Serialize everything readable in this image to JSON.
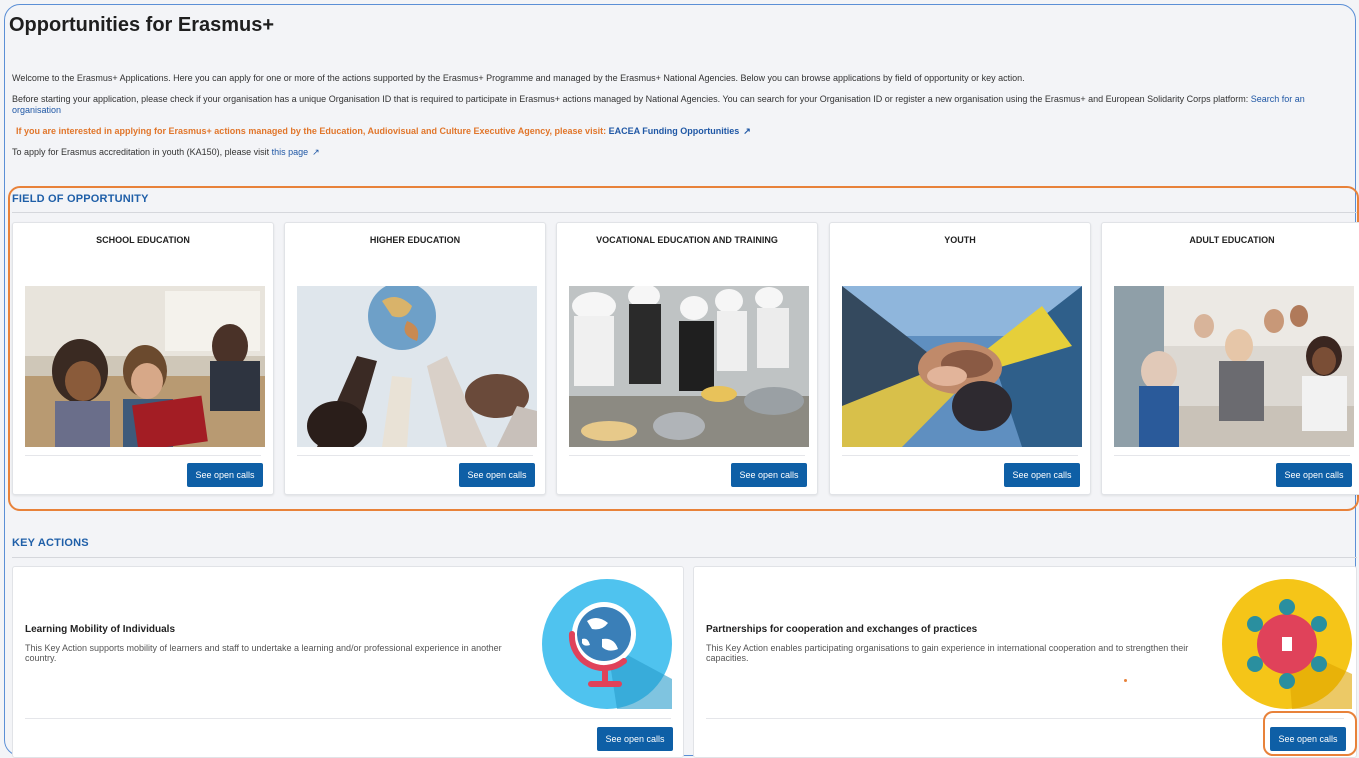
{
  "page": {
    "title": "Opportunities for Erasmus+"
  },
  "intro": {
    "welcome": "Welcome to the Erasmus+ Applications. Here you can apply for one or more of the actions supported by the Erasmus+ Programme and managed by the Erasmus+ National Agencies. Below you can browse applications by field of opportunity or key action.",
    "before_text": "Before starting your application, please check if your organisation has a unique Organisation ID that is required to participate in Erasmus+ actions managed by National Agencies. You can search for your Organisation ID or register a new organisation using the Erasmus+ and European Solidarity Corps platform: ",
    "search_link": "Search for an organisation",
    "eacea_text": "If you are interested in applying for Erasmus+ actions managed by the Education, Audiovisual and Culture Executive Agency, please visit: ",
    "eacea_link": "EACEA Funding Opportunities",
    "accreditation_text": "To apply for Erasmus accreditation in youth (KA150), please visit ",
    "accreditation_link": "this page"
  },
  "field_of_opportunity": {
    "title": "FIELD OF OPPORTUNITY",
    "cards": [
      {
        "title": "SCHOOL EDUCATION",
        "button": "See open calls"
      },
      {
        "title": "HIGHER EDUCATION",
        "button": "See open calls"
      },
      {
        "title": "VOCATIONAL EDUCATION AND TRAINING",
        "button": "See open calls"
      },
      {
        "title": "YOUTH",
        "button": "See open calls"
      },
      {
        "title": "ADULT EDUCATION",
        "button": "See open calls"
      }
    ]
  },
  "key_actions": {
    "title": "KEY ACTIONS",
    "cards": [
      {
        "title": "Learning Mobility of Individuals",
        "description": "This Key Action supports mobility of learners and staff to undertake a learning and/or professional experience in another country.",
        "button": "See open calls",
        "icon": "globe-icon"
      },
      {
        "title": "Partnerships for cooperation and exchanges of practices",
        "description": "This Key Action enables participating organisations to gain experience in international cooperation and to strengthen their capacities.",
        "button": "See open calls",
        "icon": "people-network-icon"
      }
    ]
  },
  "colors": {
    "accent_blue": "#0e5fa6",
    "section_title": "#1f5fa8",
    "highlight_orange": "#e8823a",
    "warning_text": "#e1762b"
  }
}
